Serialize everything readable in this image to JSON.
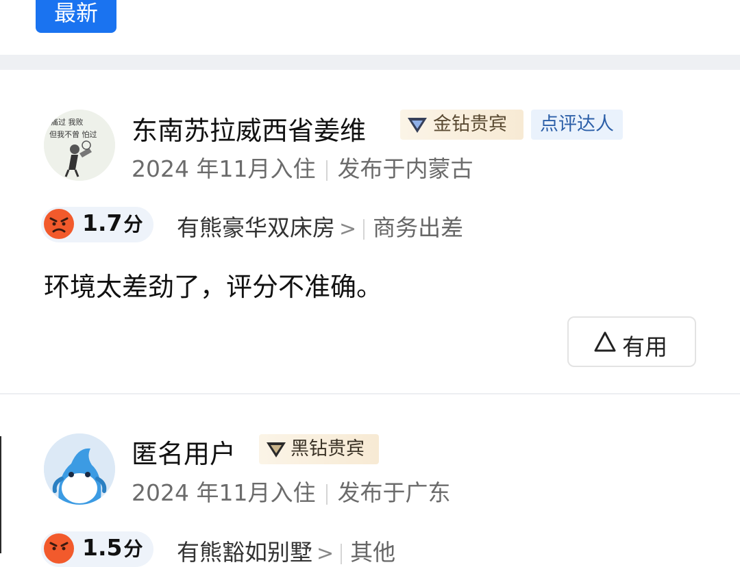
{
  "sort": {
    "latest_label": "最新"
  },
  "reviews": [
    {
      "username": "东南苏拉威西省姜维",
      "member_badge": "金钻贵宾",
      "expert_badge": "点评达人",
      "stay_date": "2024 年11月入住",
      "published_from": "发布于内蒙古",
      "score": "1.7",
      "score_unit": "分",
      "room_type": "有熊豪华双床房",
      "chevron": ">",
      "trip_type": "商务出差",
      "text": "环境太差劲了，评分不准确。",
      "helpful_label": "有用",
      "avatar_caption": "痛过 我败 但我不曾 怕过"
    },
    {
      "username": "匿名用户",
      "member_badge": "黑钻贵宾",
      "stay_date": "2024 年11月入住",
      "published_from": "发布于广东",
      "score": "1.5",
      "score_unit": "分",
      "room_type": "有熊豁如别墅",
      "chevron": ">",
      "trip_type": "其他"
    }
  ],
  "colors": {
    "primary_blue": "#1a73f0",
    "angry_face": "#f25a2c",
    "gold_badge_bg": "#f7ead4",
    "expert_badge_bg": "#eaf2fc",
    "section_gap": "#eef0f3"
  },
  "icons": {
    "gold_badge": "gold-diamond-icon",
    "black_badge": "black-diamond-icon",
    "score": "angry-face-icon",
    "helpful": "triangle-up-icon"
  }
}
